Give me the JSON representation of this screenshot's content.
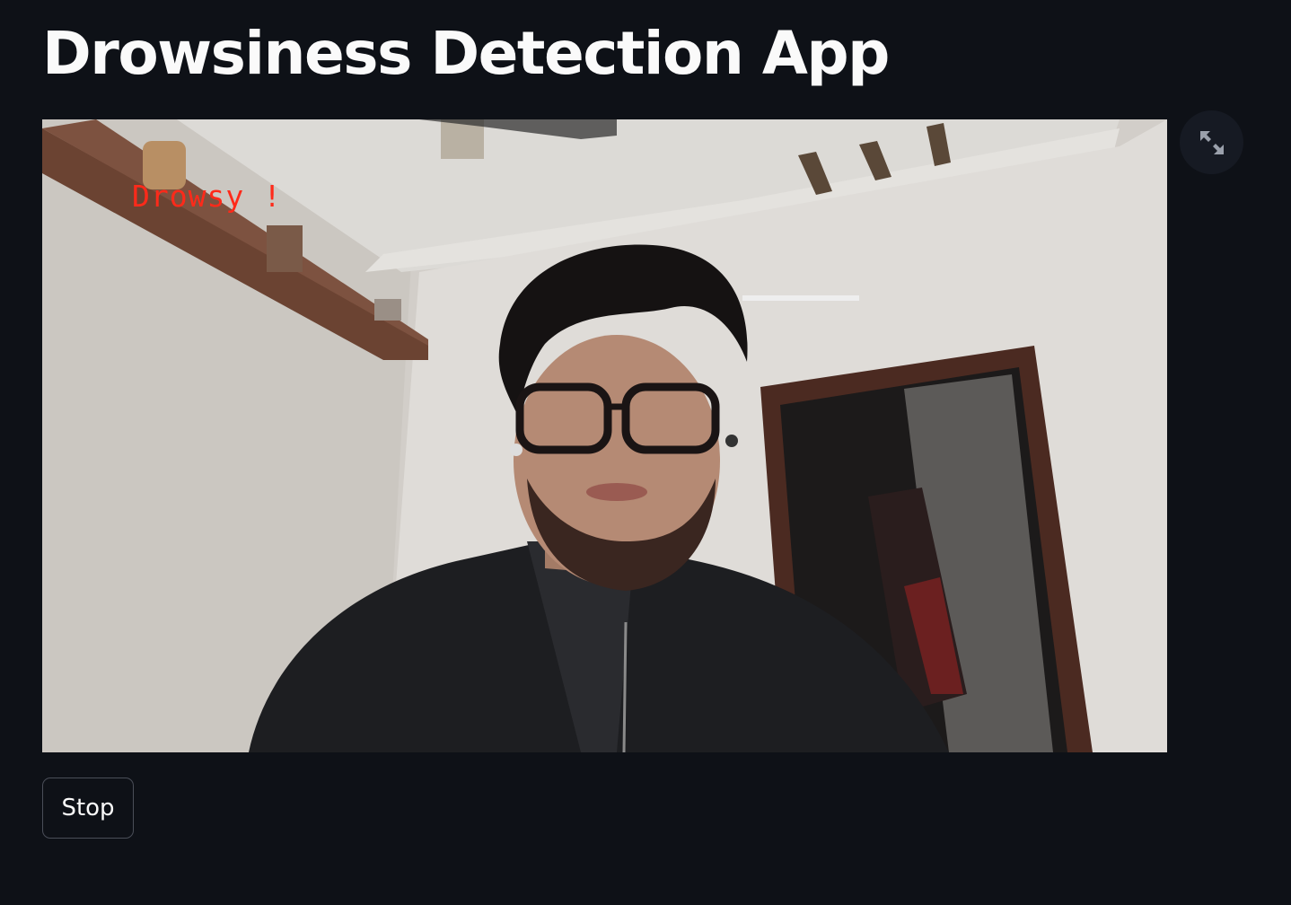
{
  "app": {
    "title": "Drowsiness Detection App"
  },
  "video": {
    "overlay_label": "Drowsy !",
    "overlay_color": "#ff2a1a"
  },
  "fullscreen_button": {
    "icon": "expand-icon"
  },
  "controls": {
    "stop_label": "Stop"
  },
  "theme": {
    "background": "#0e1117",
    "text": "#fafafa"
  }
}
